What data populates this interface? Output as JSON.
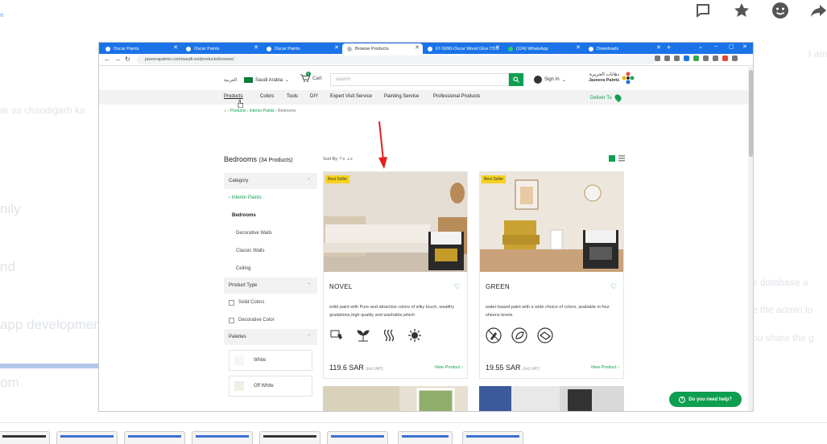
{
  "outer": {
    "bg_texts": [
      {
        "text": "nily"
      },
      {
        "text": "nd"
      },
      {
        "text": "app developmen"
      },
      {
        "text": "om"
      },
      {
        "text": "e database a"
      },
      {
        "text": "e the admin lo"
      },
      {
        "text": "ou share the g"
      },
      {
        "text": "I am"
      },
      {
        "text": "ar va chandigarh ka"
      }
    ],
    "icons": [
      "comment-icon",
      "star-icon",
      "emoji-icon",
      "share-icon"
    ]
  },
  "browser": {
    "tabs": [
      {
        "label": "Oscar Paints",
        "active": false
      },
      {
        "label": "Oscar Paints",
        "active": false
      },
      {
        "label": "Oscar Paints",
        "active": false
      },
      {
        "label": "Browse Products",
        "active": true
      },
      {
        "label": "67-5090-Oscar Wood Glue TDS",
        "active": false
      },
      {
        "label": "(124) WhatsApp",
        "active": false
      },
      {
        "label": "Downloads",
        "active": false
      }
    ],
    "url": "jazeerapaints.com/saudi-en/products/browse/"
  },
  "site": {
    "lang": "العربية",
    "region": "Saudi Arabia",
    "cart_label": "Cart",
    "cart_count": "0",
    "search_placeholder": "search",
    "signin": "Sign In",
    "logo_ar": "دهانات الجزيرة",
    "logo_en": "Jazeera Paints",
    "menu": [
      "Products",
      "Colors",
      "Tools",
      "DIY",
      "Expert Visit Service",
      "Painting Service",
      "Professional Products"
    ],
    "deliver": "Deliver To",
    "breadcrumb": [
      "Products",
      "Interior Paints",
      "Bedrooms"
    ],
    "page_title": "Bedrooms",
    "product_count": "(34 Products)",
    "sort_label": "Sort By",
    "help": "Do you need help?"
  },
  "sidebar": {
    "category_head": "Category",
    "back_link": "Interior Paints",
    "current": "Bedrooms",
    "subs": [
      "Decorative Walls",
      "Classic Walls",
      "Ceiling"
    ],
    "type_head": "Product Type",
    "types": [
      "Solid Colors",
      "Decorative Color"
    ],
    "palettes_head": "Palettes",
    "palettes": [
      "White",
      "Off White"
    ]
  },
  "products": [
    {
      "badge": "Best Seller",
      "name": "NOVEL",
      "desc": "solid paint with Pure and attractive colors of silky touch, wealthy gradations,high quality and washable,which",
      "price": "119.6 SAR",
      "vat": "(incl.VAT)",
      "view": "View Product",
      "features": [
        "touch-icon",
        "plant-icon",
        "heat-icon",
        "sun-icon"
      ]
    },
    {
      "badge": "Best Seller",
      "name": "GREEN",
      "desc": "water-based paint with a wide choice of colors, available in four sheens levels.",
      "price": "19.55 SAR",
      "vat": "(incl.VAT)",
      "view": "View Product",
      "features": [
        "no-brush-icon",
        "leaf-icon",
        "washable-icon"
      ]
    }
  ]
}
